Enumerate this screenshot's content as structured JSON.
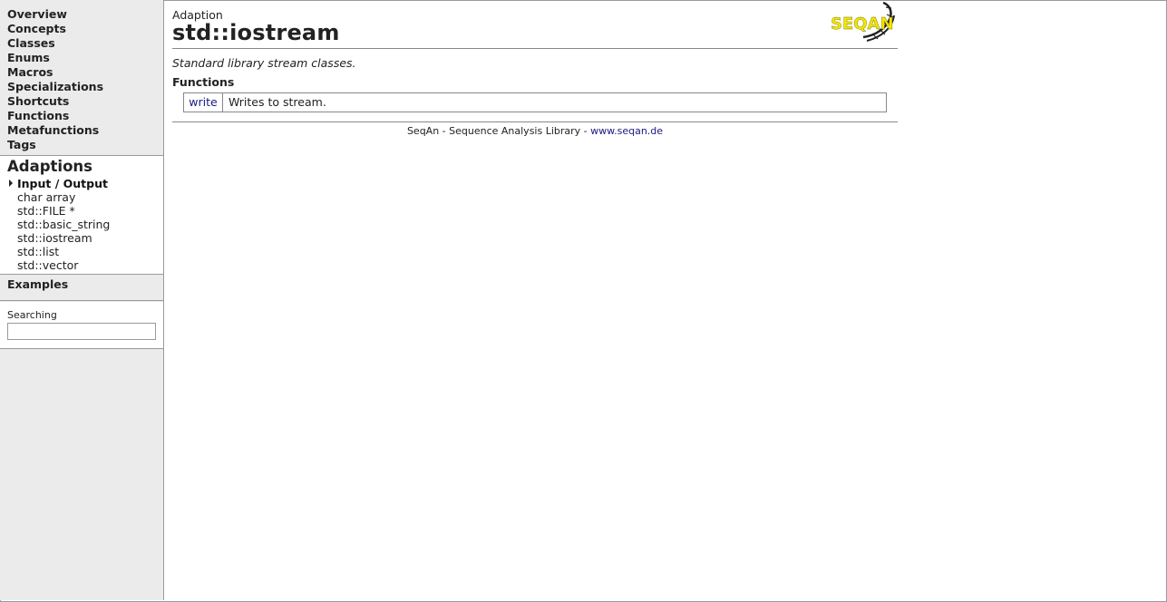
{
  "sidebar": {
    "nav": [
      "Overview",
      "Concepts",
      "Classes",
      "Enums",
      "Macros",
      "Specializations",
      "Shortcuts",
      "Functions",
      "Metafunctions",
      "Tags"
    ],
    "adaptions": {
      "title": "Adaptions",
      "category": "Input / Output",
      "items": [
        "char array",
        "std::FILE *",
        "std::basic_string",
        "std::iostream",
        "std::list",
        "std::vector"
      ]
    },
    "examples": "Examples",
    "search": {
      "label": "Searching",
      "value": "",
      "placeholder": ""
    }
  },
  "main": {
    "kind": "Adaption",
    "title": "std::iostream",
    "description": "Standard library stream classes.",
    "functions_heading": "Functions",
    "functions": [
      {
        "name": "write",
        "description": "Writes to stream."
      }
    ],
    "logo_text": "SEQAN"
  },
  "footer": {
    "text": "SeqAn - Sequence Analysis Library - ",
    "link": "www.seqan.de"
  },
  "colors": {
    "link": "#1a1a7e",
    "sidebar_bg": "#ebebeb",
    "logo_yellow": "#f2e600"
  }
}
